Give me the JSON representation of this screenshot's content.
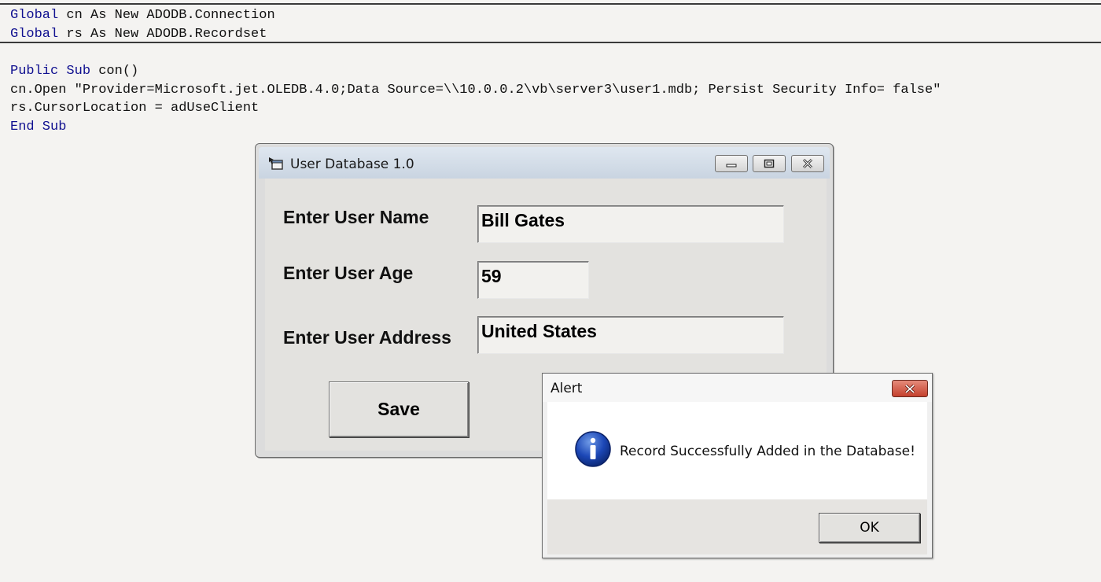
{
  "code": {
    "lines": [
      {
        "kw": "Global",
        "rest": " cn As New ADODB.Connection"
      },
      {
        "kw": "Global",
        "rest": " rs As New ADODB.Recordset"
      },
      {
        "kw": "Public Sub",
        "rest": " con()"
      },
      {
        "kw": "",
        "rest": "cn.Open \"Provider=Microsoft.jet.OLEDB.4.0;Data Source=\\\\10.0.0.2\\vb\\server3\\user1.mdb; Persist Security Info= false\""
      },
      {
        "kw": "",
        "rest": "rs.CursorLocation = adUseClient"
      },
      {
        "kw": "End Sub",
        "rest": ""
      }
    ]
  },
  "form": {
    "title": "User Database 1.0",
    "fields": {
      "name": {
        "label": "Enter User Name",
        "value": "Bill Gates"
      },
      "age": {
        "label": "Enter User Age",
        "value": "59"
      },
      "address": {
        "label": "Enter User Address",
        "value": "United States"
      }
    },
    "save_label": "Save"
  },
  "alert": {
    "title": "Alert",
    "message": "Record Successfully Added in the Database!",
    "ok_label": "OK"
  }
}
